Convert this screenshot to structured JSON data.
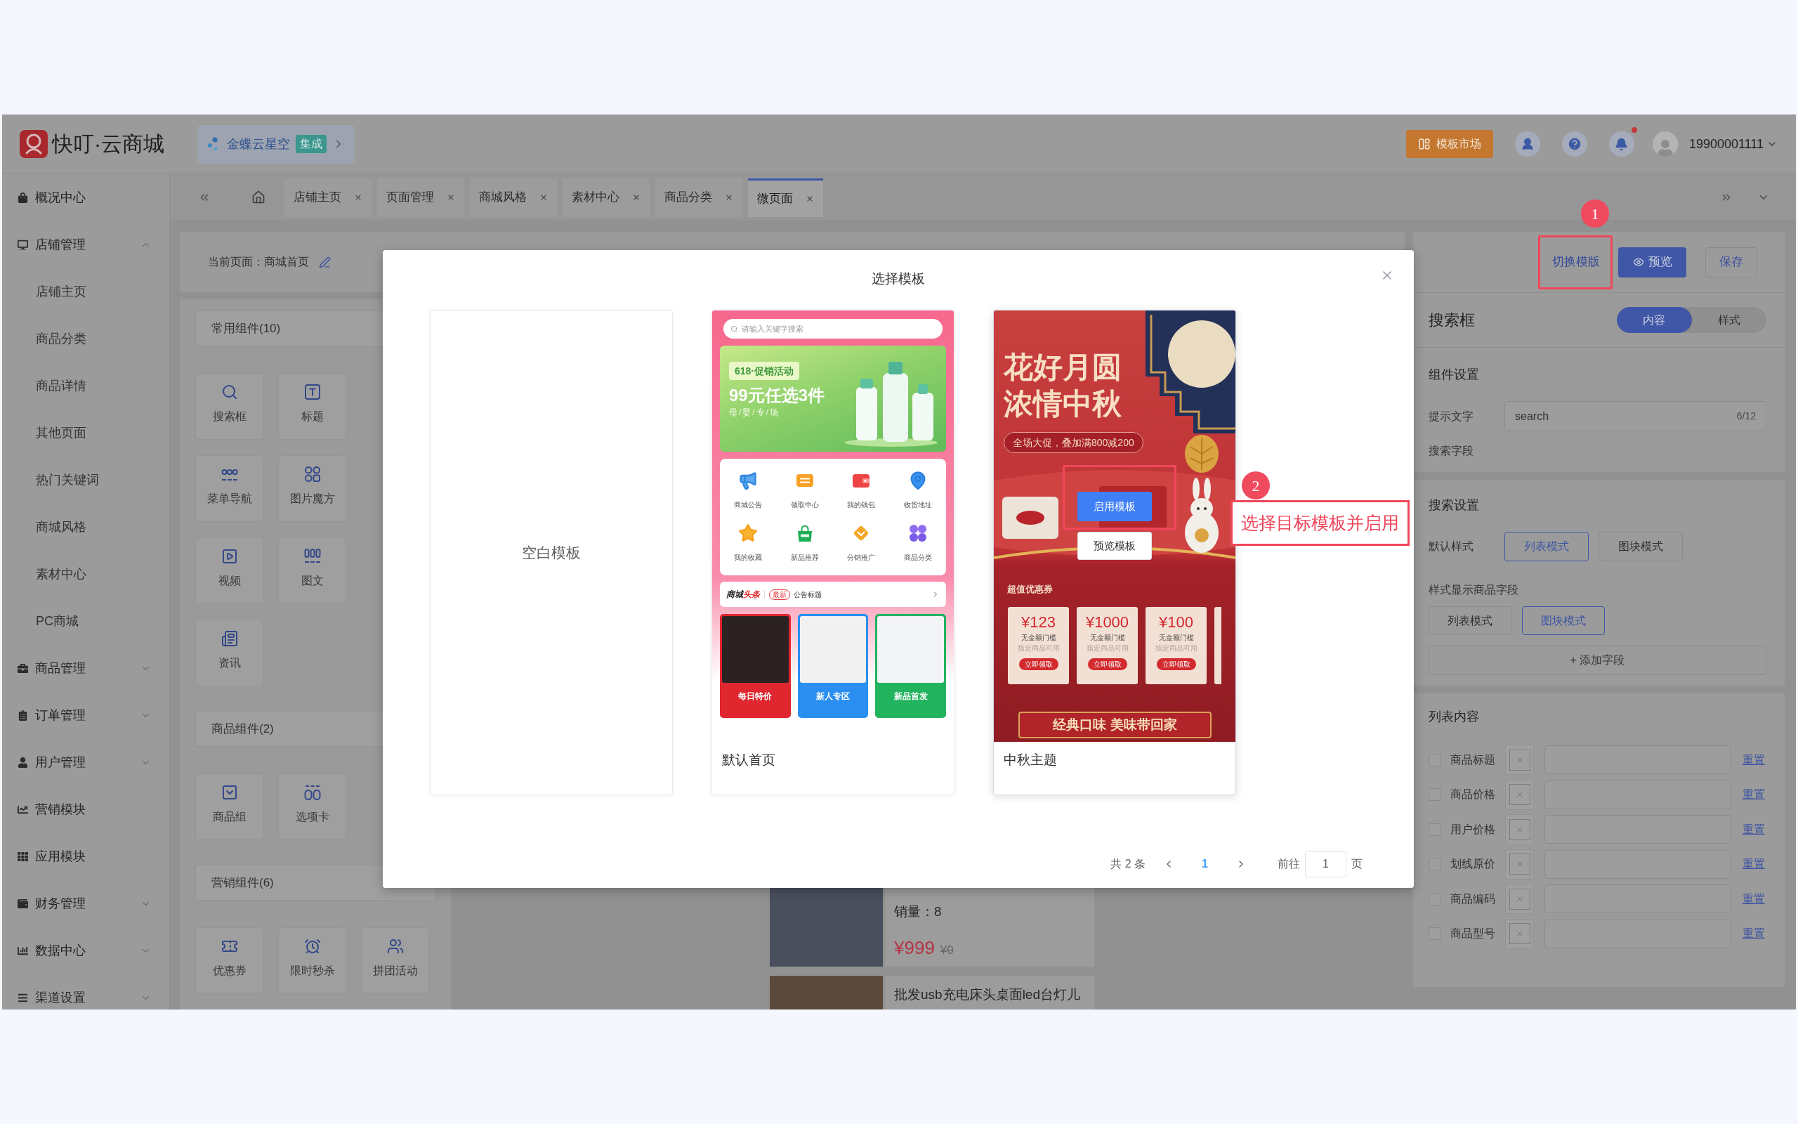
{
  "header": {
    "brand": "快叮·云商城",
    "integration": {
      "name": "金蝶云星空",
      "badge": "集成"
    },
    "market_button": "模板市场",
    "notification_dot": true,
    "user": "19900001111"
  },
  "sidebar": {
    "items": [
      {
        "label": "概况中心",
        "kind": "link"
      },
      {
        "label": "店铺管理",
        "kind": "group",
        "expanded": true,
        "children": [
          {
            "label": "店铺主页"
          },
          {
            "label": "商品分类"
          },
          {
            "label": "商品详情"
          },
          {
            "label": "其他页面"
          },
          {
            "label": "热门关键词"
          },
          {
            "label": "商城风格"
          },
          {
            "label": "素材中心"
          },
          {
            "label": "PC商城"
          }
        ]
      },
      {
        "label": "商品管理",
        "kind": "group",
        "expanded": false
      },
      {
        "label": "订单管理",
        "kind": "group",
        "expanded": false
      },
      {
        "label": "用户管理",
        "kind": "group",
        "expanded": false
      },
      {
        "label": "营销模块",
        "kind": "link"
      },
      {
        "label": "应用模块",
        "kind": "link"
      },
      {
        "label": "财务管理",
        "kind": "group",
        "expanded": false
      },
      {
        "label": "数据中心",
        "kind": "group",
        "expanded": false
      },
      {
        "label": "渠道设置",
        "kind": "group",
        "expanded": false
      }
    ]
  },
  "tabs": [
    {
      "label": "店铺主页",
      "selected": false
    },
    {
      "label": "页面管理",
      "selected": false
    },
    {
      "label": "商城风格",
      "selected": false
    },
    {
      "label": "素材中心",
      "selected": false
    },
    {
      "label": "商品分类",
      "selected": false
    },
    {
      "label": "微页面",
      "selected": true
    }
  ],
  "toolbar": {
    "current_page": "当前页面：商城首页",
    "switch_template": "切换模版",
    "preview": "预览",
    "save": "保存"
  },
  "components": {
    "sections": [
      {
        "title": "常用组件(10)",
        "rows": [
          [
            {
              "label": "搜索框",
              "kind": "search"
            },
            {
              "label": "标题",
              "kind": "title"
            }
          ],
          [
            {
              "label": "菜单导航",
              "kind": "menu"
            },
            {
              "label": "图片魔方",
              "kind": "cube"
            }
          ],
          [
            {
              "label": "视频",
              "kind": "video"
            },
            {
              "label": "图文",
              "kind": "article"
            }
          ],
          [
            {
              "label": "资讯",
              "kind": "news"
            }
          ]
        ]
      },
      {
        "title": "商品组件(2)",
        "rows": [
          [
            {
              "label": "商品组",
              "kind": "goods"
            },
            {
              "label": "选项卡",
              "kind": "tabs"
            }
          ]
        ]
      },
      {
        "title": "营销组件(6)",
        "rows": [
          [
            {
              "label": "优惠券",
              "kind": "coupon"
            },
            {
              "label": "限时秒杀",
              "kind": "flash"
            },
            {
              "label": "拼团活动",
              "kind": "teamup"
            }
          ]
        ]
      }
    ]
  },
  "canvas": {
    "product": {
      "sales": "销量：8",
      "price": "¥999",
      "original_price": "¥0"
    },
    "next_product": {
      "title": "批发usb充电床头桌面led台灯儿"
    }
  },
  "settings": {
    "title": "搜索框",
    "tabs": [
      {
        "label": "内容",
        "selected": true
      },
      {
        "label": "样式",
        "selected": false
      }
    ],
    "component_settings": {
      "title": "组件设置",
      "hint_label": "提示文字",
      "hint_value": "search",
      "hint_count": "6/12",
      "field_label": "搜索字段"
    },
    "search_settings": {
      "title": "搜索设置",
      "default_style_label": "默认样式",
      "default_styles": [
        {
          "label": "列表模式",
          "selected": true
        },
        {
          "label": "图块模式",
          "selected": false
        }
      ],
      "display_label": "样式显示商品字段",
      "display_styles": [
        {
          "label": "列表模式",
          "selected": false
        },
        {
          "label": "图块模式",
          "selected": true
        }
      ],
      "add_field": "+ 添加字段"
    },
    "list_content": {
      "title": "列表内容",
      "rows": [
        {
          "label": "商品标题",
          "checked": false,
          "reset": "重置"
        },
        {
          "label": "商品价格",
          "checked": false,
          "reset": "重置"
        },
        {
          "label": "用户价格",
          "checked": false,
          "reset": "重置"
        },
        {
          "label": "划线原价",
          "checked": false,
          "reset": "重置"
        },
        {
          "label": "商品编码",
          "checked": false,
          "reset": "重置"
        },
        {
          "label": "商品型号",
          "checked": false,
          "reset": "重置"
        }
      ]
    }
  },
  "modal": {
    "title": "选择模板",
    "templates": [
      {
        "kind": "blank",
        "label": "空白模板",
        "hovered": false
      },
      {
        "kind": "shop",
        "caption": "默认首页",
        "hovered": false,
        "search_placeholder": "请输入关键字搜索",
        "banner": {
          "tag": "618·促销活动",
          "headline": "99元任选3件",
          "subline": "母/婴/专/场"
        },
        "shortcuts": [
          {
            "label": "商城公告"
          },
          {
            "label": "领取中心"
          },
          {
            "label": "我的钱包"
          },
          {
            "label": "收货地址"
          },
          {
            "label": "我的收藏"
          },
          {
            "label": "新品推荐"
          },
          {
            "label": "分销推广"
          },
          {
            "label": "商品分类"
          }
        ],
        "news": {
          "brand": "商城",
          "brand_accent": "头条",
          "tag": "最新",
          "title": "公告标题"
        },
        "promos": [
          {
            "label": "每日特价",
            "color": "#e0262f"
          },
          {
            "label": "新人专区",
            "color": "#2a8ff0"
          },
          {
            "label": "新品首发",
            "color": "#22b35e"
          }
        ]
      },
      {
        "kind": "festival",
        "caption": "中秋主题",
        "hovered": true,
        "actions": {
          "apply": "启用模板",
          "preview": "预览模板"
        },
        "headline": [
          "花好月圆",
          "浓情中秋"
        ],
        "offer": "全场大促，叠加满800减200",
        "coupons_title": "超值优惠券",
        "coupons": [
          {
            "amount": "¥123",
            "condition": "无金额门槛",
            "scope": "指定商品可用",
            "action": "立即领取"
          },
          {
            "amount": "¥1000",
            "condition": "无金额门槛",
            "scope": "指定商品可用",
            "action": "立即领取"
          },
          {
            "amount": "¥100",
            "condition": "无金额门槛",
            "scope": "指定商品可用",
            "action": "立即领取"
          }
        ],
        "ribbon": "经典口味 美味带回家"
      }
    ],
    "pagination": {
      "total": "共 2 条",
      "pages": [
        {
          "label": "1",
          "selected": true
        }
      ],
      "goto": "前往",
      "goto_value": "1",
      "suffix": "页"
    }
  },
  "annotations": [
    {
      "number": "1"
    },
    {
      "number": "2",
      "note": "选择目标模板并启用"
    }
  ]
}
